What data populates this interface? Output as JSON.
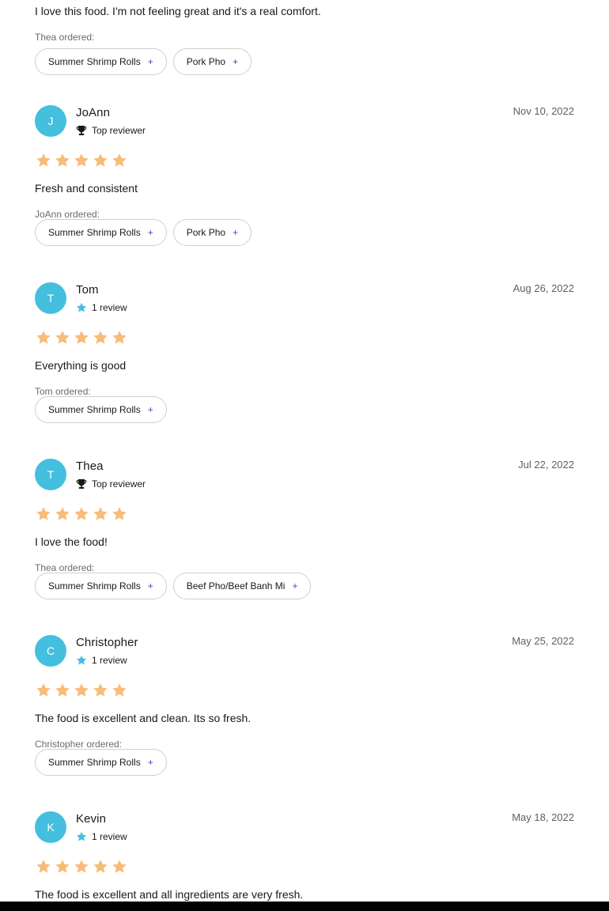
{
  "colors": {
    "avatar_bg": "#44bfde",
    "star": "#f7bc79",
    "plus": "#4b3fc4",
    "chip_border": "#cfcfcf",
    "top_bar_bottom": "#000000"
  },
  "partial_review": {
    "text": "I love this food. I'm not feeling great and it's a real comfort.",
    "ordered_label": "Thea ordered:",
    "items": [
      "Summer Shrimp Rolls",
      "Pork Pho"
    ]
  },
  "reviews": [
    {
      "initial": "J",
      "name": "JoAnn",
      "badge_icon": "trophy-icon",
      "badge": "Top reviewer",
      "date": "Nov 10, 2022",
      "rating": 5,
      "text": "Fresh and consistent",
      "ordered_label": "JoAnn ordered:",
      "items": [
        "Summer Shrimp Rolls",
        "Pork Pho"
      ]
    },
    {
      "initial": "T",
      "name": "Tom",
      "badge_icon": "star-icon",
      "badge": "1 review",
      "date": "Aug 26, 2022",
      "rating": 5,
      "text": "Everything is good",
      "ordered_label": "Tom ordered:",
      "items": [
        "Summer Shrimp Rolls"
      ]
    },
    {
      "initial": "T",
      "name": "Thea",
      "badge_icon": "trophy-icon",
      "badge": "Top reviewer",
      "date": "Jul 22, 2022",
      "rating": 5,
      "text": "I love the food!",
      "ordered_label": "Thea ordered:",
      "items": [
        "Summer Shrimp Rolls",
        "Beef Pho/Beef Banh Mi"
      ]
    },
    {
      "initial": "C",
      "name": "Christopher",
      "badge_icon": "star-icon",
      "badge": "1 review",
      "date": "May 25, 2022",
      "rating": 5,
      "text": "The food is excellent and clean. Its so fresh.",
      "ordered_label": "Christopher ordered:",
      "items": [
        "Summer Shrimp Rolls"
      ]
    },
    {
      "initial": "K",
      "name": "Kevin",
      "badge_icon": "star-icon",
      "badge": "1 review",
      "date": "May 18, 2022",
      "rating": 5,
      "text": "The food is excellent and all ingredients are very fresh.",
      "ordered_label": "",
      "items": []
    }
  ]
}
